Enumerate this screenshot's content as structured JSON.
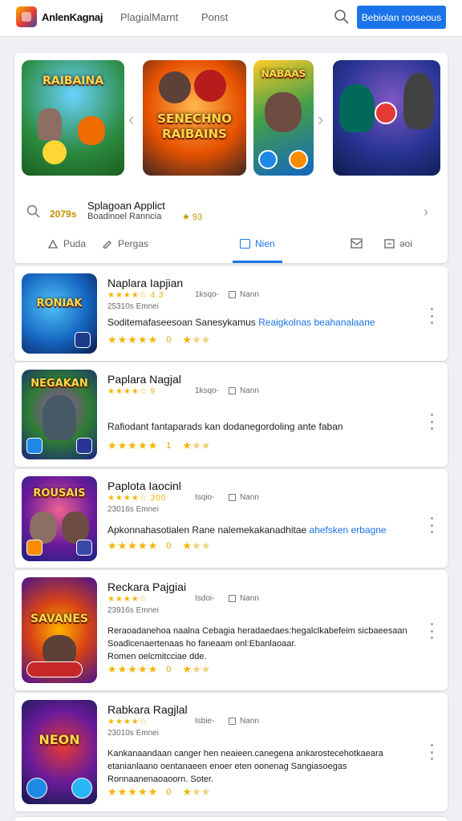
{
  "header": {
    "brand": "AnlenKagnaj",
    "nav": [
      "PlagialMarnt",
      "Ponst"
    ],
    "cta": "Bebiolan rooseous"
  },
  "hero": {
    "banners": [
      {
        "label": "RAIBAINA"
      },
      {
        "label": "SENECHNO RAIBAINS"
      },
      {
        "label": "NABAAS"
      },
      {
        "label": ""
      }
    ],
    "count": "2079s",
    "title": "Splagoan Applict",
    "subtitle": "Boadinoel Ranncia",
    "rating": "★ 93",
    "tabs": [
      {
        "label": "Puda",
        "active": false
      },
      {
        "label": "Pergas",
        "active": false
      },
      {
        "label": "Nien",
        "active": true
      },
      {
        "label": "",
        "active": false
      },
      {
        "label": "əoi",
        "active": false
      }
    ]
  },
  "apps": [
    {
      "thumb_text": "RONIAK",
      "title": "Naplara Iapjian",
      "rating_small": "4.3",
      "meta1": "1ksqo-",
      "meta2": "Nann",
      "release": "25310s Emnei",
      "desc": [
        "Soditemafaseesoan Sanesykamus ",
        "Reaigkolnas beahanalaane"
      ],
      "score": "0"
    },
    {
      "thumb_text": "NEGAKAN",
      "title": "Paplara Nagjal",
      "rating_small": "9",
      "meta1": "1ksqo-",
      "meta2": "Nann",
      "release": "",
      "desc": [
        "Rafiodant fantaparads kan dodanegordoling ante faban"
      ],
      "score": "1"
    },
    {
      "thumb_text": "ROUSAIS",
      "title": "Paplota Iaocinl",
      "rating_small": "300",
      "meta1": "Isqio-",
      "meta2": "Nann",
      "release": "23016s Emnei",
      "desc": [
        "Apkonnahasotialen Rane nalemekakanadhitae ",
        "ahefsken erbagne"
      ],
      "score": "0"
    },
    {
      "thumb_text": "SAVANES",
      "title": "Reckara Pajgiai",
      "rating_small": "",
      "meta1": "Isdoi-",
      "meta2": "Nann",
      "release": "23916s Emnei",
      "desc": [
        "Reraoadanehoa naalna Cebagia heradaedaes:hegalclkabefeim sicbaeesaan",
        "Soadlcenaertenaas ho faneaam onl:Ebanlaoaar.",
        "Romen oelcmitcciae dde."
      ],
      "score": "0"
    },
    {
      "thumb_text": "NEON",
      "title": "Rabkara Ragjlal",
      "rating_small": "",
      "meta1": "Isbie-",
      "meta2": "Nann",
      "release": "23010s Emnei",
      "desc": [
        "Kankanaandaan canger hen neaieen.canegena ankarostecehotkaeara",
        "etanianlaano oentanaeen enoer eten oonenag Sangiasoegas",
        "Ronnaanenaoaoorn. Soter."
      ],
      "score": "0"
    }
  ],
  "colors": {
    "accent": "#1a73e8",
    "star": "#f4b400"
  }
}
